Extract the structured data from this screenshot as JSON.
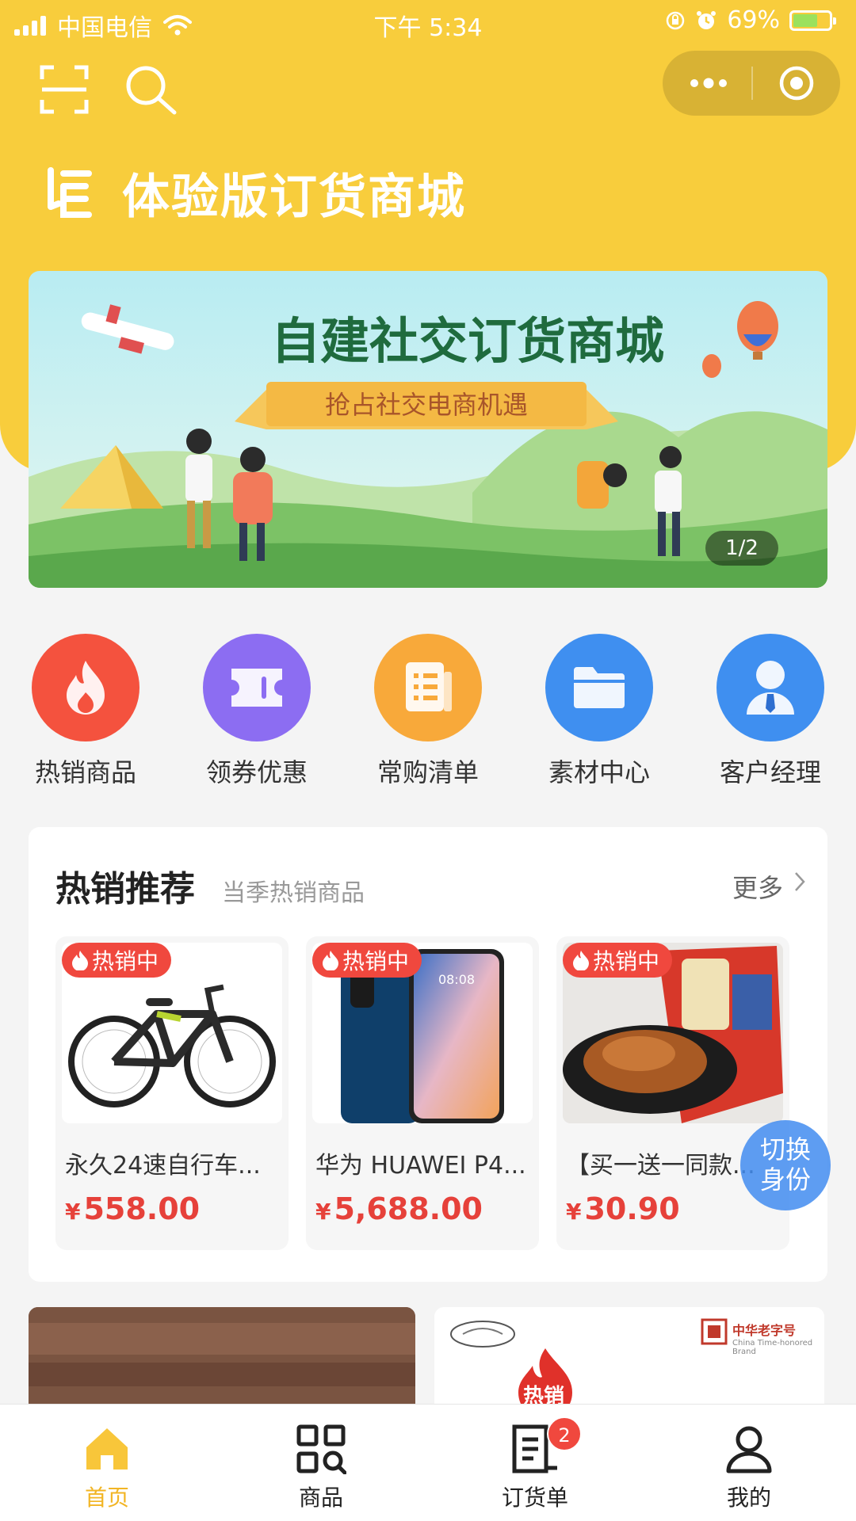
{
  "status_bar": {
    "carrier": "中国电信",
    "time": "下午 5:34",
    "battery": "69%",
    "battery_level": 0.69
  },
  "header": {
    "store_title": "体验版订货商城",
    "menu_dots": "•••"
  },
  "banner": {
    "headline": "自建社交订货商城",
    "ribbon": "抢占社交电商机遇",
    "page_indicator": "1/2"
  },
  "quick_nav": [
    {
      "label": "热销商品",
      "icon": "fire-icon",
      "color": "#f4523e"
    },
    {
      "label": "领券优惠",
      "icon": "ticket-icon",
      "color": "#8c6df2"
    },
    {
      "label": "常购清单",
      "icon": "list-icon",
      "color": "#f8a93a"
    },
    {
      "label": "素材中心",
      "icon": "folder-icon",
      "color": "#3f8ff0"
    },
    {
      "label": "客户经理",
      "icon": "user-tie-icon",
      "color": "#3f8ff0"
    }
  ],
  "hot_section": {
    "title": "热销推荐",
    "subtitle": "当季热销商品",
    "more": "更多",
    "products": [
      {
        "badge": "热销中",
        "name": "永久24速自行车...",
        "currency": "¥",
        "price": "558.00"
      },
      {
        "badge": "热销中",
        "name": "华为 HUAWEI P4...",
        "currency": "¥",
        "price": "5,688.00"
      },
      {
        "badge": "热销中",
        "name": "【买一送一同款...",
        "currency": "¥",
        "price": "30.90"
      }
    ]
  },
  "switch_identity": {
    "line1": "切换",
    "line2": "身份"
  },
  "promo": {
    "brand": "中华老字号",
    "brand_en": "China Time-honored Brand",
    "hot_text": "热销"
  },
  "tab_bar": {
    "tabs": [
      {
        "label": "首页",
        "icon": "home-icon",
        "active": true
      },
      {
        "label": "商品",
        "icon": "grid-search-icon",
        "active": false
      },
      {
        "label": "订货单",
        "icon": "order-icon",
        "active": false
      },
      {
        "label": "我的",
        "icon": "user-icon",
        "active": false
      }
    ],
    "order_badge": "2"
  },
  "colors": {
    "brand_yellow": "#f8cd3c",
    "price_red": "#e6413a",
    "active_tab": "#f2b524"
  }
}
